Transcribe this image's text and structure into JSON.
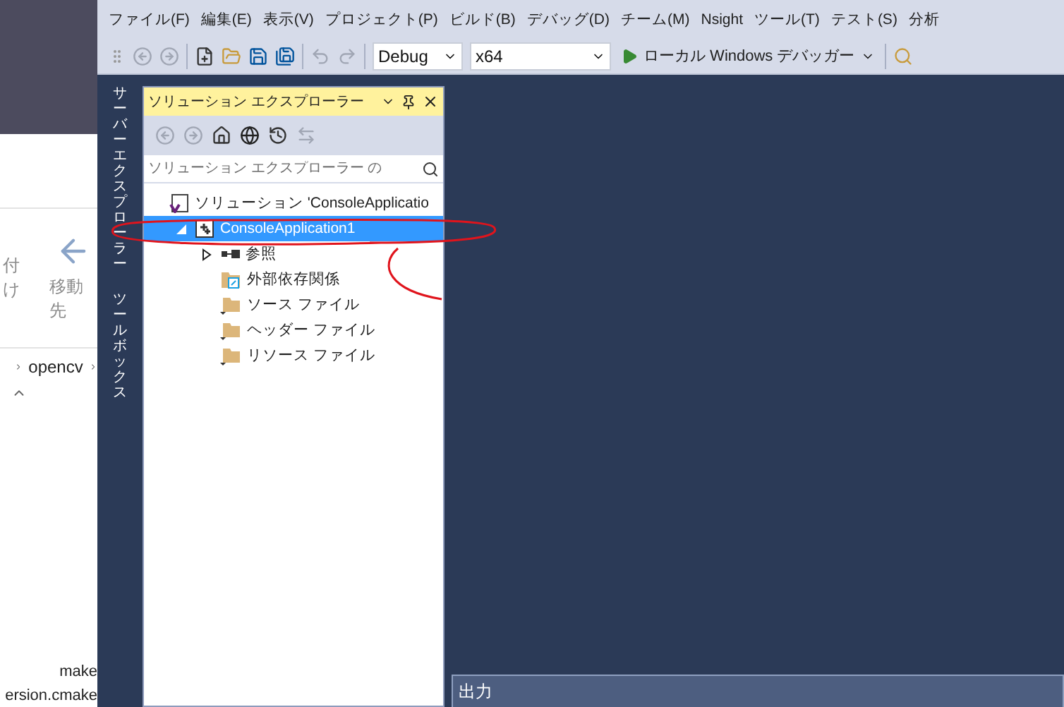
{
  "background_window": {
    "ribbon_cut_label": "付け",
    "ribbon_button": "移動先",
    "breadcrumb": "opencv",
    "files": [
      "make",
      "ersion.cmake"
    ]
  },
  "menu": [
    "ファイル(F)",
    "編集(E)",
    "表示(V)",
    "プロジェクト(P)",
    "ビルド(B)",
    "デバッグ(D)",
    "チーム(M)",
    "Nsight",
    "ツール(T)",
    "テスト(S)",
    "分析"
  ],
  "toolbar": {
    "configuration": "Debug",
    "platform": "x64",
    "run_button": "ローカル Windows デバッガー"
  },
  "side_tabs": [
    "サーバーエクスプローラー",
    "ツールボックス"
  ],
  "solution_explorer": {
    "title": "ソリューション エクスプローラー",
    "search": {
      "placeholder": "ソリューション エクスプローラー の"
    },
    "tree": [
      {
        "kind": "solution",
        "label": "ソリューション 'ConsoleApplicatio",
        "selected": false,
        "children": [
          {
            "kind": "project",
            "label": "ConsoleApplication1",
            "selected": true,
            "expanded": true,
            "children": [
              {
                "kind": "references",
                "label": "参照",
                "selected": false,
                "expanded": false
              },
              {
                "kind": "external",
                "label": "外部依存関係",
                "selected": false
              },
              {
                "kind": "filter",
                "label": "ソース ファイル",
                "selected": false
              },
              {
                "kind": "filter",
                "label": "ヘッダー ファイル",
                "selected": false
              },
              {
                "kind": "filter",
                "label": "リソース ファイル",
                "selected": false
              }
            ]
          }
        ]
      }
    ]
  },
  "output_panel": {
    "title": "出力"
  }
}
